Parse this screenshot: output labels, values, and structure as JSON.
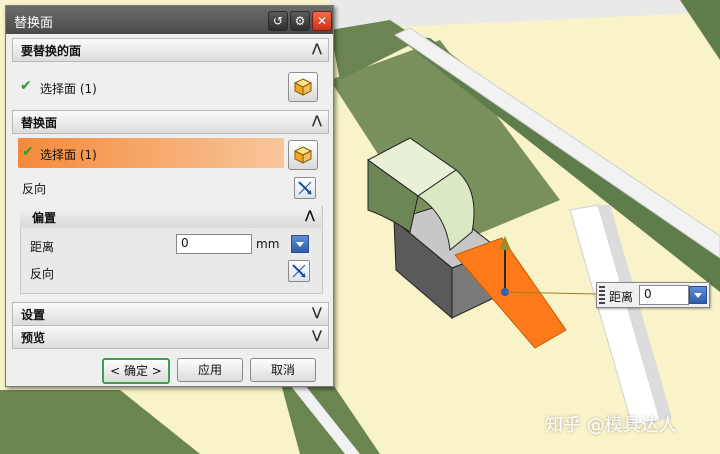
{
  "dialog": {
    "title": "替换面",
    "sections": {
      "face_to_replace": {
        "title": "要替换的面",
        "selection_label": "选择面 (1)"
      },
      "replacement_face": {
        "title": "替换面",
        "selection_label": "选择面 (1)",
        "reverse_label": "反向"
      },
      "offset": {
        "title": "偏置",
        "distance_label": "距离",
        "distance_value": "0",
        "unit": "mm",
        "reverse_label": "反向"
      },
      "settings": {
        "title": "设置"
      },
      "preview": {
        "title": "预览"
      }
    },
    "buttons": {
      "ok": "< 确定 >",
      "apply": "应用",
      "cancel": "取消"
    }
  },
  "floating_input": {
    "label": "距离",
    "value": "0"
  },
  "watermark": "知乎 @模具达人",
  "colors": {
    "highlight_orange": "#ff7a1a",
    "model_green": "#5f7d4a",
    "floor": "#f7f2c8"
  }
}
